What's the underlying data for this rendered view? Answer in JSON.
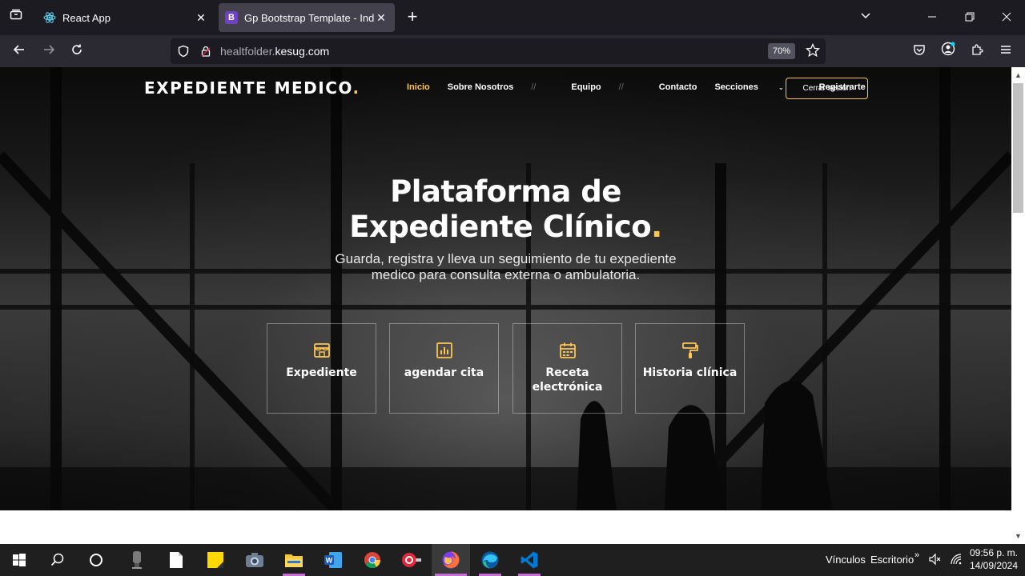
{
  "browser": {
    "tabs": [
      {
        "title": "React App",
        "active": false
      },
      {
        "title": "Gp Bootstrap Template - Index",
        "active": true
      }
    ],
    "url": {
      "prefix": "healtfolder.",
      "domain": "kesug.com"
    },
    "zoom": "70%"
  },
  "site": {
    "logo": "EXPEDIENTE MEDICO",
    "logo_dot": ".",
    "nav": [
      {
        "label": "Inicio",
        "active": true
      },
      {
        "label": "Sobre Nosotros",
        "active": false
      },
      {
        "label": "Equipo",
        "active": false
      },
      {
        "label": "Contacto",
        "active": false
      },
      {
        "label": "Secciones",
        "active": false
      },
      {
        "label": "Registrarte",
        "active": false
      }
    ],
    "logout_label": "Cerrar sesión",
    "hero": {
      "title_line1": "Plataforma de",
      "title_line2": "Expediente Clínico",
      "title_dot": ".",
      "subtitle_line1": "Guarda, registra y lleva un seguimiento de tu expediente",
      "subtitle_line2": "medico para consulta externa o ambulatoria."
    },
    "features": [
      {
        "label": "Expediente",
        "icon": "store-icon"
      },
      {
        "label": "agendar cita",
        "icon": "bar-chart-icon"
      },
      {
        "label": "Receta electrónica",
        "icon": "calendar-icon"
      },
      {
        "label": "Historia clínica",
        "icon": "paint-roller-icon"
      }
    ]
  },
  "taskbar": {
    "links_label": "Vínculos",
    "desktop_label": "Escritorio",
    "time": "09:56 p. m.",
    "date": "14/09/2024"
  },
  "colors": {
    "accent": "#ffc451",
    "browser_bg": "#1c1b22",
    "toolbar_bg": "#2b2a33",
    "taskbar_bg": "#1f1f1f"
  }
}
